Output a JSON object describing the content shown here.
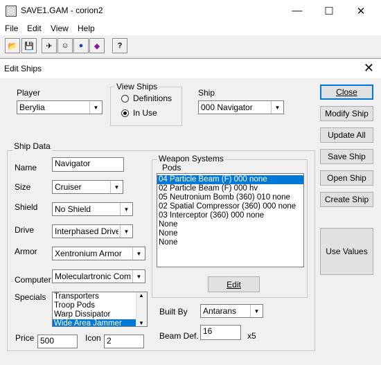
{
  "app": {
    "title": "SAVE1.GAM - corion2"
  },
  "window_controls": {
    "minimize": "—",
    "maximize": "☐",
    "close": "✕"
  },
  "menu": [
    "File",
    "Edit",
    "View",
    "Help"
  ],
  "toolbar": [
    {
      "icon": "open-folder-icon",
      "glyph": "📂"
    },
    {
      "icon": "save-disk-icon",
      "glyph": "💾"
    },
    {
      "icon": "ship-icon",
      "glyph": "✈"
    },
    {
      "icon": "face-icon",
      "glyph": "☺"
    },
    {
      "icon": "planet-icon",
      "glyph": "●"
    },
    {
      "icon": "gem-icon",
      "glyph": "◆"
    },
    {
      "icon": "help-icon",
      "glyph": "?"
    }
  ],
  "dialog": {
    "title": "Edit Ships",
    "close": "✕",
    "player": {
      "label": "Player",
      "value": "Berylia"
    },
    "view_ships": {
      "label": "View Ships",
      "options": [
        "Definitions",
        "In Use"
      ],
      "selected": 1
    },
    "ship": {
      "label": "Ship",
      "value": "000 Navigator"
    },
    "buttons": {
      "close": "Close",
      "modify_ship": "Modify Ship",
      "update_all": "Update All",
      "save_ship": "Save Ship",
      "open_ship": "Open Ship",
      "create_ship": "Create Ship",
      "use_values": "Use Values"
    },
    "ship_data": {
      "label": "Ship Data",
      "name": {
        "label": "Name",
        "value": "Navigator"
      },
      "size": {
        "label": "Size",
        "value": "Cruiser"
      },
      "shield": {
        "label": "Shield",
        "value": "No Shield"
      },
      "drive": {
        "label": "Drive",
        "value": "Interphased Drive"
      },
      "armor": {
        "label": "Armor",
        "value": "Xentronium Armor"
      },
      "computer": {
        "label": "Computer",
        "value": "Moleculartronic Compute"
      },
      "specials": {
        "label": "Specials",
        "items": [
          "Transporters",
          "Troop Pods",
          "Warp Dissipator",
          "Wide Area Jammer"
        ],
        "selected": 3
      },
      "price": {
        "label": "Price",
        "value": "500"
      },
      "icon": {
        "label": "Icon",
        "value": "2"
      },
      "weapons": {
        "label": "Weapon Systems",
        "sublabel": "Pods",
        "items": [
          "04 Particle Beam (F) 000 none",
          "02 Particle Beam (F) 000 hv",
          "05 Neutronium Bomb (360) 010 none",
          "02 Spatial Compressor (360) 000 none",
          "03 Interceptor (360) 000 none",
          "None",
          "None",
          "None"
        ],
        "selected": 0,
        "edit": "Edit"
      },
      "built_by": {
        "label": "Built By",
        "value": "Antarans"
      },
      "beam_def": {
        "label": "Beam Def.",
        "value": "16",
        "suffix": "x5"
      }
    }
  }
}
